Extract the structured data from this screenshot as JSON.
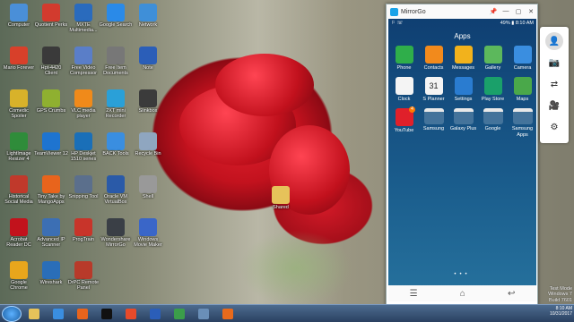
{
  "desktop": {
    "icons": [
      {
        "label": "Computer",
        "color": "#4a8fd8"
      },
      {
        "label": "Quotient Perks",
        "color": "#d23b2e"
      },
      {
        "label": "MXTE Multimedia...",
        "color": "#2a6bbd"
      },
      {
        "label": "Google Search",
        "color": "#2a8ae8"
      },
      {
        "label": "Network",
        "color": "#3f8fd8"
      },
      {
        "label": "Mario Forever",
        "color": "#d8402a"
      },
      {
        "label": "Hpt-4420 Client",
        "color": "#3a3a3a"
      },
      {
        "label": "Free Video Compressor",
        "color": "#5a7ec8"
      },
      {
        "label": "Free Item Documents",
        "color": "#777777"
      },
      {
        "label": "Note",
        "color": "#2b5eb8"
      },
      {
        "label": "Comedic Spoiler",
        "color": "#d8b22a"
      },
      {
        "label": "GPS Crumbs",
        "color": "#8fb030"
      },
      {
        "label": "VLC media player",
        "color": "#f08a1a"
      },
      {
        "label": "2XT mini Recorder",
        "color": "#2aa0d8"
      },
      {
        "label": "Slinkbox",
        "color": "#3b3b3b"
      },
      {
        "label": "LightImage Resizer 4",
        "color": "#2f8c3a"
      },
      {
        "label": "TeamViewer 12",
        "color": "#1e74d0"
      },
      {
        "label": "HP Deskjet 1510 series",
        "color": "#1a6fb8"
      },
      {
        "label": "BACK Tools",
        "color": "#3a8ee0"
      },
      {
        "label": "Recycle Bin",
        "color": "#8fa6c0"
      },
      {
        "label": "Historical Social Media",
        "color": "#c0392b"
      },
      {
        "label": "Tiny Take by MangoApps",
        "color": "#e8641c"
      },
      {
        "label": "Snipping Tool",
        "color": "#5b6f8c"
      },
      {
        "label": "Oracle VM VirtualBox",
        "color": "#2a5aa8"
      },
      {
        "label": "Shell",
        "color": "#999999"
      },
      {
        "label": "Acrobat Reader DC",
        "color": "#c2121c"
      },
      {
        "label": "Advanced IP Scanner",
        "color": "#3c6fb4"
      },
      {
        "label": "ProgTrain",
        "color": "#c8342a"
      },
      {
        "label": "Wondershare MirrorGo",
        "color": "#3a3f46"
      },
      {
        "label": "Windows Movie Maker",
        "color": "#3a66c8"
      },
      {
        "label": "Google Chrome",
        "color": "#e8a61c"
      },
      {
        "label": "Wireshark",
        "color": "#2a6eb8"
      },
      {
        "label": "DrPC Remote Panel",
        "color": "#b83a2a"
      }
    ],
    "shared_folder": {
      "label": "Shared"
    }
  },
  "taskbar": {
    "items": [
      {
        "name": "explorer",
        "color": "#e6c25a"
      },
      {
        "name": "ie",
        "color": "#3a8ee0"
      },
      {
        "name": "media",
        "color": "#e8641c"
      },
      {
        "name": "cmd",
        "color": "#111111"
      },
      {
        "name": "chrome",
        "color": "#e84a2a"
      },
      {
        "name": "word",
        "color": "#2b5eb8"
      },
      {
        "name": "mirrorgo",
        "color": "#3b9e4a"
      },
      {
        "name": "app8",
        "color": "#6a8fb8"
      },
      {
        "name": "app9",
        "color": "#e86a1c"
      }
    ],
    "time": "8:10 AM",
    "date": "10/31/2017"
  },
  "watermark": [
    "Test Mode",
    "Windows 7",
    "Build 7601"
  ],
  "mirrorgo": {
    "title": "MirrorGo",
    "window_controls": [
      "📌",
      "—",
      "▢",
      "✕"
    ],
    "status_time": "8:10 AM",
    "status_battery": "49%",
    "apps_title": "Apps",
    "apps": [
      {
        "label": "Phone",
        "color": "#2fae4a"
      },
      {
        "label": "Contacts",
        "color": "#f28a1c"
      },
      {
        "label": "Messages",
        "color": "#f2b21c"
      },
      {
        "label": "Gallery",
        "color": "#5cb85c"
      },
      {
        "label": "Camera",
        "color": "#3a8ee0"
      },
      {
        "label": "Clock",
        "color": "#f4f4f4"
      },
      {
        "label": "S Planner",
        "color": "#f4f4f4"
      },
      {
        "label": "Settings",
        "color": "#2a7cd0"
      },
      {
        "label": "Play Store",
        "color": "#1aa06a"
      },
      {
        "label": "Maps",
        "color": "#4aa84a"
      },
      {
        "label": "YouTube",
        "color": "#e0202a"
      }
    ],
    "folders": [
      "Samsung",
      "Galaxy Plus",
      "Google",
      "Samsung Apps"
    ],
    "splanner_day": "31",
    "youtube_badge": "4"
  },
  "toolbar": {
    "tools": [
      "avatar",
      "screenshot-icon",
      "rotate-icon",
      "record-icon",
      "settings-icon"
    ]
  }
}
